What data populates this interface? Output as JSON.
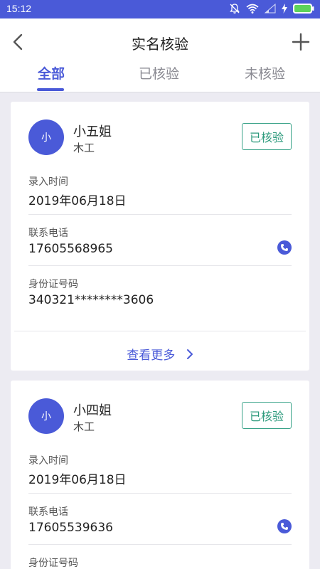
{
  "status_bar": {
    "time": "15:12"
  },
  "header": {
    "title": "实名核验"
  },
  "tabs": [
    {
      "label": "全部",
      "active": true
    },
    {
      "label": "已核验",
      "active": false
    },
    {
      "label": "未核验",
      "active": false
    }
  ],
  "colors": {
    "accent": "#4a5ad8",
    "badge": "#3aa389"
  },
  "cards": [
    {
      "avatar_text": "小",
      "name": "小五姐",
      "role": "木工",
      "badge": "已核验",
      "entry_time_label": "录入时间",
      "entry_time": "2019年06月18日",
      "phone_label": "联系电话",
      "phone": "17605568965",
      "id_label": "身份证号码",
      "id_number": "340321********3606",
      "more_label": "查看更多"
    },
    {
      "avatar_text": "小",
      "name": "小四姐",
      "role": "木工",
      "badge": "已核验",
      "entry_time_label": "录入时间",
      "entry_time": "2019年06月18日",
      "phone_label": "联系电话",
      "phone": "17605539636",
      "id_label": "身份证号码"
    }
  ],
  "icons": [
    "back-arrow-icon",
    "plus-icon",
    "phone-icon",
    "chevron-right-icon",
    "mute-bell-icon",
    "wifi-icon",
    "signal-icon",
    "charging-icon",
    "battery-icon"
  ]
}
